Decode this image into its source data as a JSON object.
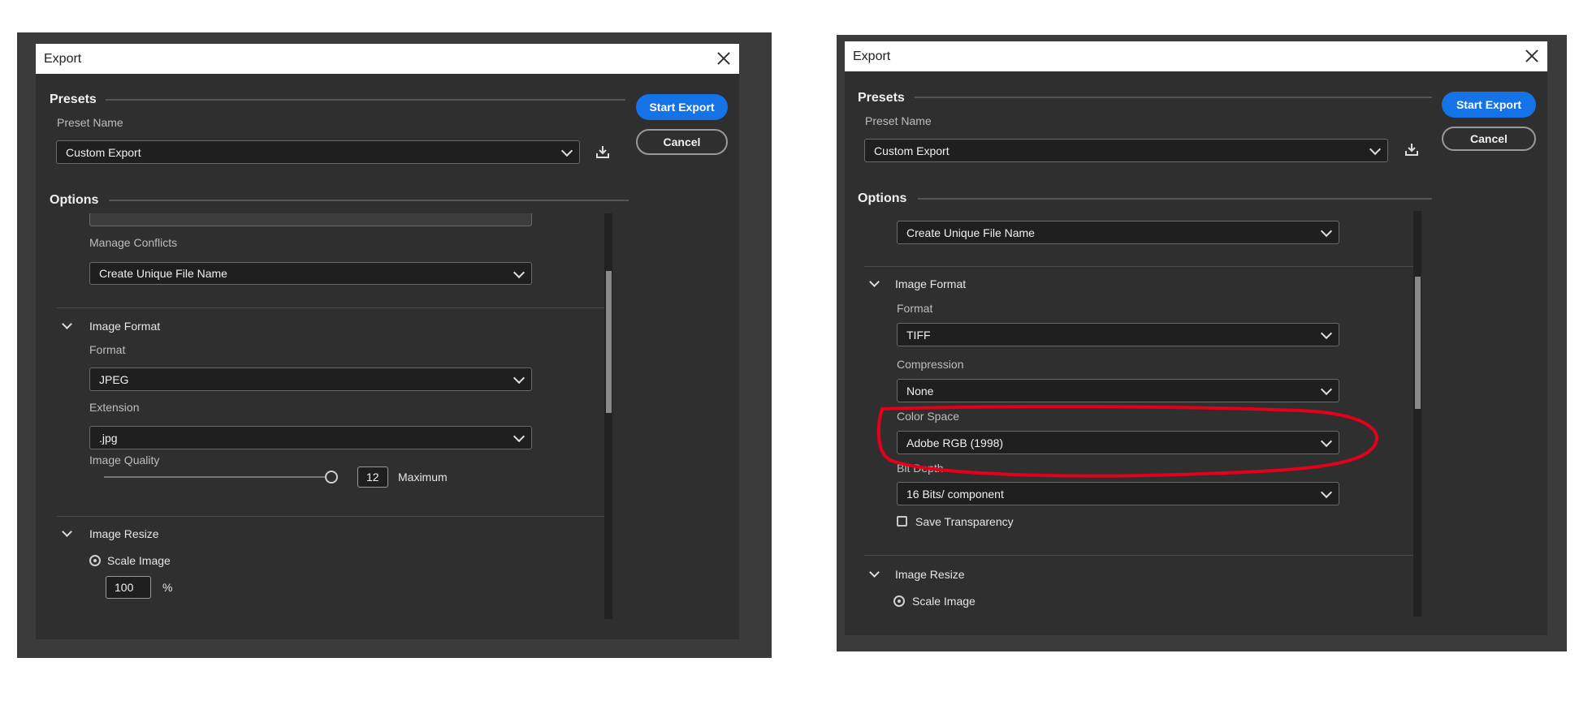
{
  "left": {
    "title": "Export",
    "presets_heading": "Presets",
    "preset_name_label": "Preset Name",
    "preset_name_value": "Custom Export",
    "start_export": "Start Export",
    "cancel": "Cancel",
    "options_heading": "Options",
    "manage_conflicts_label": "Manage Conflicts",
    "manage_conflicts_value": "Create Unique File Name",
    "image_format_heading": "Image Format",
    "format_label": "Format",
    "format_value": "JPEG",
    "extension_label": "Extension",
    "extension_value": ".jpg",
    "image_quality_label": "Image Quality",
    "image_quality_value": "12",
    "image_quality_text": "Maximum",
    "image_quality_level": 1.0,
    "image_resize_heading": "Image Resize",
    "scale_image_label": "Scale Image",
    "scale_value": "100",
    "scale_unit": "%"
  },
  "right": {
    "title": "Export",
    "presets_heading": "Presets",
    "preset_name_label": "Preset Name",
    "preset_name_value": "Custom Export",
    "start_export": "Start Export",
    "cancel": "Cancel",
    "options_heading": "Options",
    "manage_conflicts_value": "Create Unique File Name",
    "image_format_heading": "Image Format",
    "format_label": "Format",
    "format_value": "TIFF",
    "compression_label": "Compression",
    "compression_value": "None",
    "color_space_label": "Color Space",
    "color_space_value": "Adobe RGB (1998)",
    "bit_depth_label": "Bit Depth",
    "bit_depth_value": "16 Bits/ component",
    "save_transparency_label": "Save Transparency",
    "image_resize_heading": "Image Resize",
    "scale_image_label": "Scale Image"
  },
  "colors": {
    "accent": "#1473e6",
    "annotation": "#e3001b"
  },
  "icons": [
    "close-icon",
    "save-preset-icon",
    "chevron-down-icon",
    "radio-selected-icon"
  ]
}
